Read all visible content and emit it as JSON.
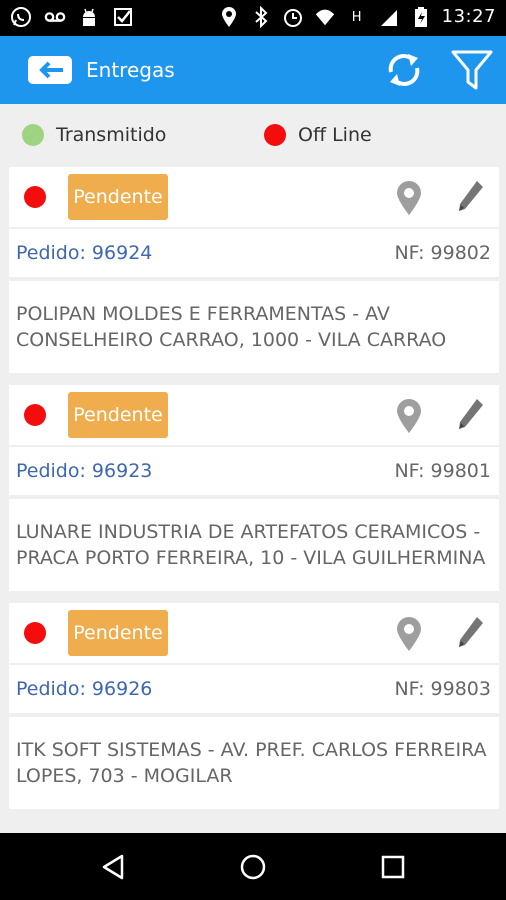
{
  "status_bar": {
    "time": "13:27",
    "left_icons": [
      "whatsapp-icon",
      "voicemail-icon",
      "android-icon",
      "checkmark-app-icon"
    ],
    "right_icons": [
      "location-icon",
      "bluetooth-icon",
      "alarm-icon",
      "wifi-icon",
      "h-signal-icon",
      "signal-icon",
      "battery-icon"
    ],
    "network_label": "H"
  },
  "app_bar": {
    "title": "Entregas",
    "color": "#1e96ee"
  },
  "legend": {
    "items": [
      {
        "label": "Transmitido",
        "color": "#9ed481"
      },
      {
        "label": "Off Line",
        "color": "#f50c0c"
      }
    ]
  },
  "deliveries": [
    {
      "status": "Pendente",
      "pedido": "Pedido: 96924",
      "nf": "NF: 99802",
      "address": "POLIPAN MOLDES E FERRAMENTAS - AV CONSELHEIRO CARRAO, 1000 - VILA CARRAO"
    },
    {
      "status": "Pendente",
      "pedido": "Pedido: 96923",
      "nf": "NF: 99801",
      "address": "LUNARE INDUSTRIA DE ARTEFATOS CERAMICOS - PRACA PORTO FERREIRA, 10 - VILA GUILHERMINA"
    },
    {
      "status": "Pendente",
      "pedido": "Pedido: 96926",
      "nf": "NF: 99803",
      "address": "ITK SOFT SISTEMAS - AV. PREF. CARLOS FERREIRA LOPES, 703 - MOGILAR"
    }
  ],
  "colors": {
    "badge": "#f0ad4e",
    "offline_dot": "#f50c0c",
    "pedido_text": "#3d67b1"
  }
}
